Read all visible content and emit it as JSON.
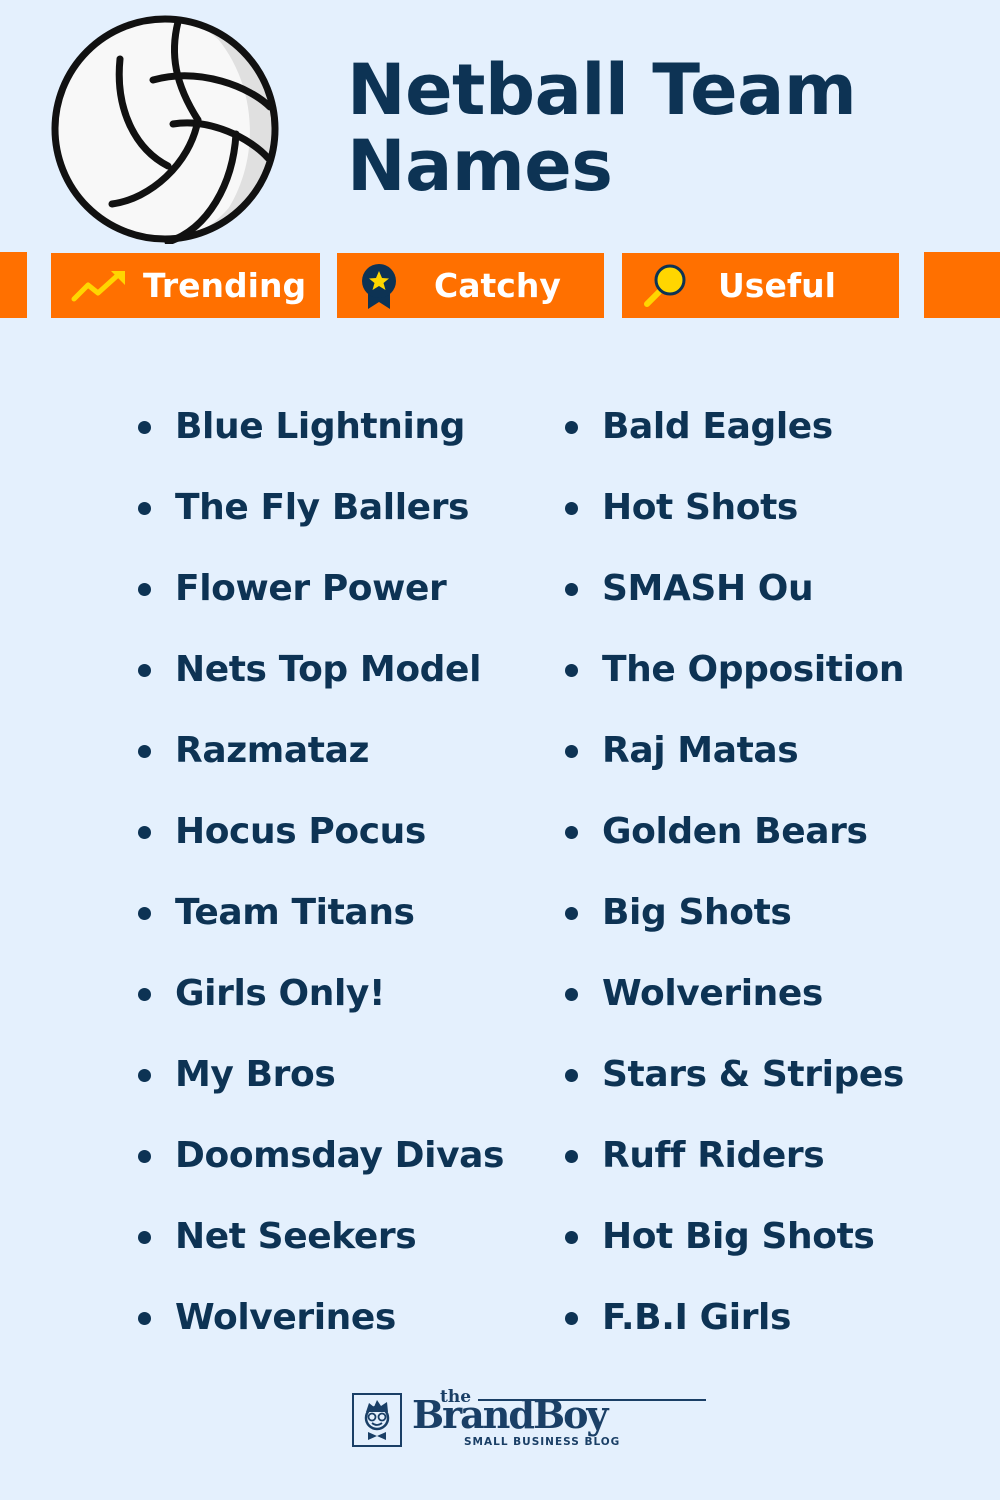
{
  "header": {
    "title_line1": "Netball Team",
    "title_line2": "Names",
    "ball_icon": "volleyball-icon"
  },
  "tags": [
    {
      "label": "Trending",
      "icon": "trending-up-arrow-icon"
    },
    {
      "label": "Catchy",
      "icon": "award-ribbon-star-icon"
    },
    {
      "label": "Useful",
      "icon": "magnifying-glass-icon"
    }
  ],
  "colors": {
    "background": "#e4f0fd",
    "accent": "#ff7000",
    "text": "#0d3354",
    "icon_yellow": "#ffd600"
  },
  "names": {
    "left": [
      "Blue Lightning",
      "The Fly Ballers",
      "Flower Power",
      "Nets Top Model",
      "Razmataz",
      "Hocus Pocus",
      "Team Titans",
      "Girls Only!",
      "My Bros",
      "Doomsday Divas",
      "Net Seekers",
      "Wolverines"
    ],
    "right": [
      "Bald Eagles",
      "Hot Shots",
      "SMASH Ou",
      "The Opposition",
      "Raj Matas",
      "Golden Bears",
      "Big Shots",
      "Wolverines",
      "Stars & Stripes",
      "Ruff Riders",
      "Hot Big Shots",
      "F.B.I Girls"
    ]
  },
  "footer": {
    "logo_the": "the",
    "logo_brand": "BrandBoy",
    "logo_tagline": "SMALL BUSINESS BLOG"
  }
}
